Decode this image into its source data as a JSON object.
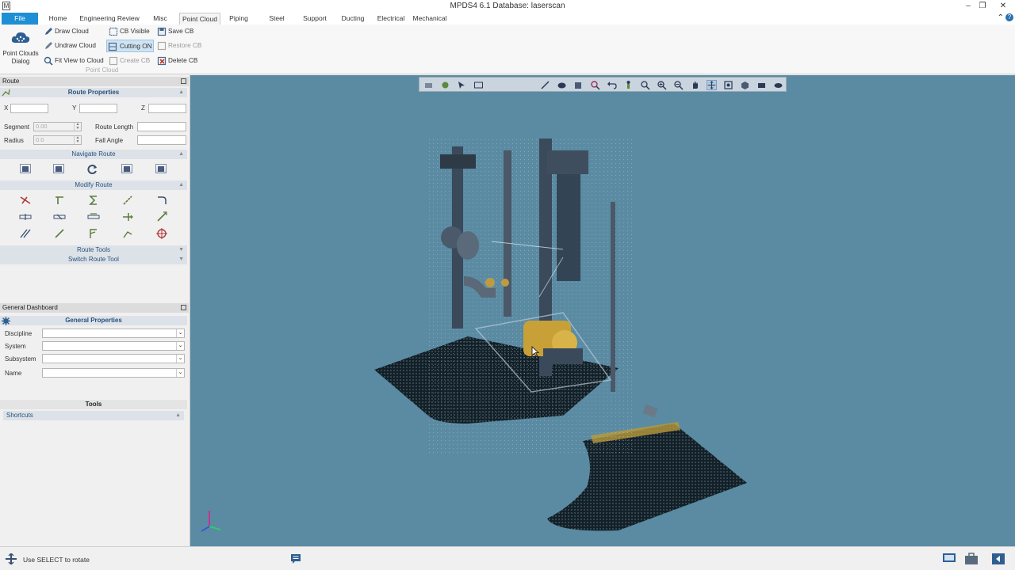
{
  "window": {
    "title": "MPDS4 6.1  Database: laserscan",
    "controls": [
      "minimize",
      "restore",
      "close"
    ]
  },
  "ribbon_tabs": [
    "File",
    "Home",
    "Engineering Review",
    "Misc",
    "Point Cloud",
    "Piping",
    "Steel",
    "Support",
    "Ducting",
    "Electrical",
    "Mechanical"
  ],
  "active_tab": "Point Cloud",
  "ribbon": {
    "big_button": "Point Clouds Dialog",
    "col1": [
      "Draw Cloud",
      "Undraw Cloud",
      "Fit View to Cloud"
    ],
    "col2": [
      "CB Visible",
      "Cutting ON",
      "Create CB"
    ],
    "col3": [
      "Save CB",
      "Restore CB",
      "Delete CB"
    ],
    "group_label": "Point Cloud"
  },
  "route_panel": {
    "title": "Route",
    "properties_header": "Route Properties",
    "x_label": "X",
    "y_label": "Y",
    "z_label": "Z",
    "segment_label": "Segment",
    "segment_value": "0.00",
    "route_length_label": "Route Length",
    "radius_label": "Radius",
    "radius_value": "0.0",
    "fall_angle_label": "Fall Angle",
    "navigate_header": "Navigate Route",
    "modify_header": "Modify Route",
    "tools_header": "Route Tools",
    "switch_header": "Switch Route Tool"
  },
  "dashboard": {
    "title": "General Dashboard",
    "properties_header": "General Properties",
    "fields": [
      "Discipline",
      "System",
      "Subsystem",
      "Name"
    ],
    "tools_header": "Tools",
    "shortcuts_header": "Shortcuts"
  },
  "status": {
    "message": "Use SELECT to rotate"
  },
  "colors": {
    "viewport_bg": "#5a8ba3",
    "file_tab": "#1e8fd4",
    "section_head": "#dde2e8"
  }
}
